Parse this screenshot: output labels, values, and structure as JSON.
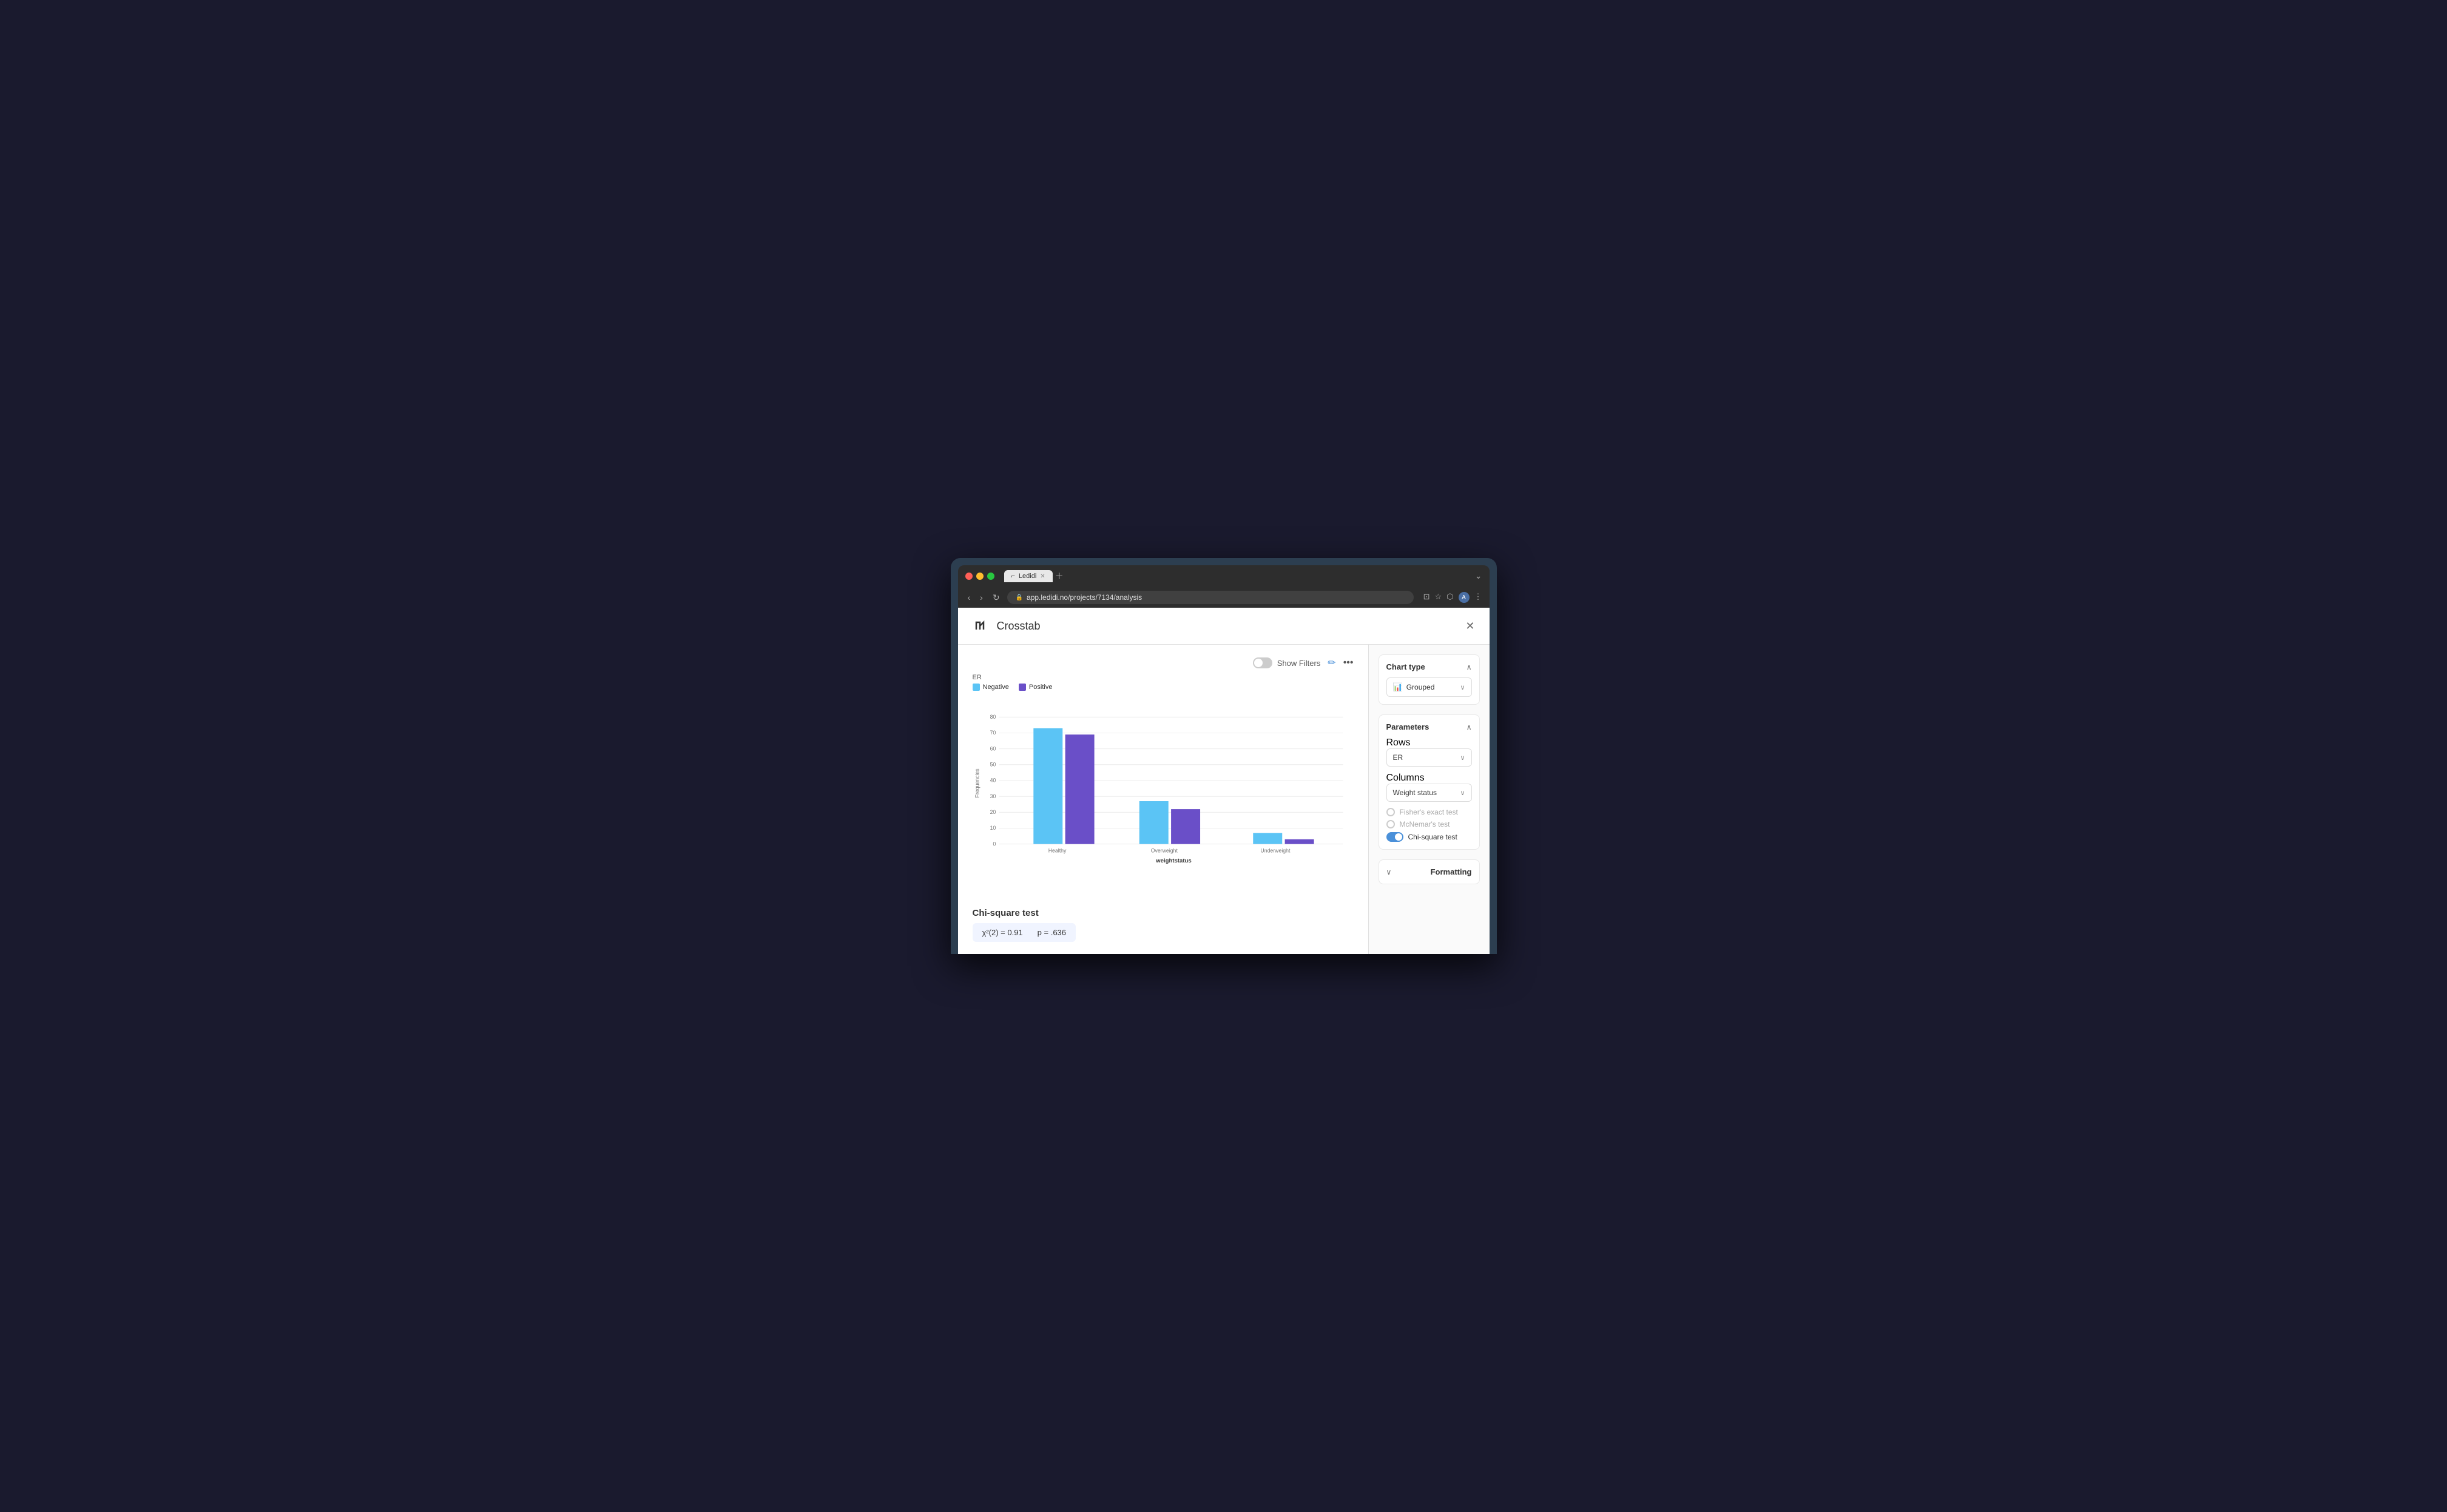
{
  "browser": {
    "url": "app.ledidi.no/projects/7134/analysis",
    "tab_title": "Ledidi",
    "traffic_lights": [
      "red",
      "yellow",
      "green"
    ]
  },
  "header": {
    "title": "Crosstab",
    "logo": "⌐",
    "close_label": "×",
    "show_filters_label": "Show Filters"
  },
  "chart": {
    "y_label": "Frequencies",
    "x_label": "weightstatus",
    "chart_label": "ER",
    "legend": [
      {
        "label": "Negative",
        "color": "#5bc4f5"
      },
      {
        "label": "Positive",
        "color": "#6a4fc8"
      }
    ],
    "groups": [
      {
        "name": "Healthy",
        "negative": 73,
        "positive": 69
      },
      {
        "name": "Overweight",
        "negative": 27,
        "positive": 22
      },
      {
        "name": "Underweight",
        "negative": 7,
        "positive": 3
      }
    ],
    "y_max": 80,
    "y_ticks": [
      0,
      10,
      20,
      30,
      40,
      50,
      60,
      70,
      80
    ]
  },
  "chi_square": {
    "title": "Chi-square test",
    "stat": "χ²(2) = 0.91",
    "pval": "p = .636"
  },
  "sidebar": {
    "chart_type_title": "Chart type",
    "chart_type_value": "Grouped",
    "chart_type_icon": "📊",
    "parameters_title": "Parameters",
    "rows_label": "Rows",
    "rows_value": "ER",
    "columns_label": "Columns",
    "columns_value": "Weight status",
    "tests": [
      {
        "label": "Fisher's exact test",
        "active": false
      },
      {
        "label": "McNemar's test",
        "active": false
      },
      {
        "label": "Chi-square test",
        "active": true
      }
    ],
    "formatting_label": "Formatting"
  }
}
